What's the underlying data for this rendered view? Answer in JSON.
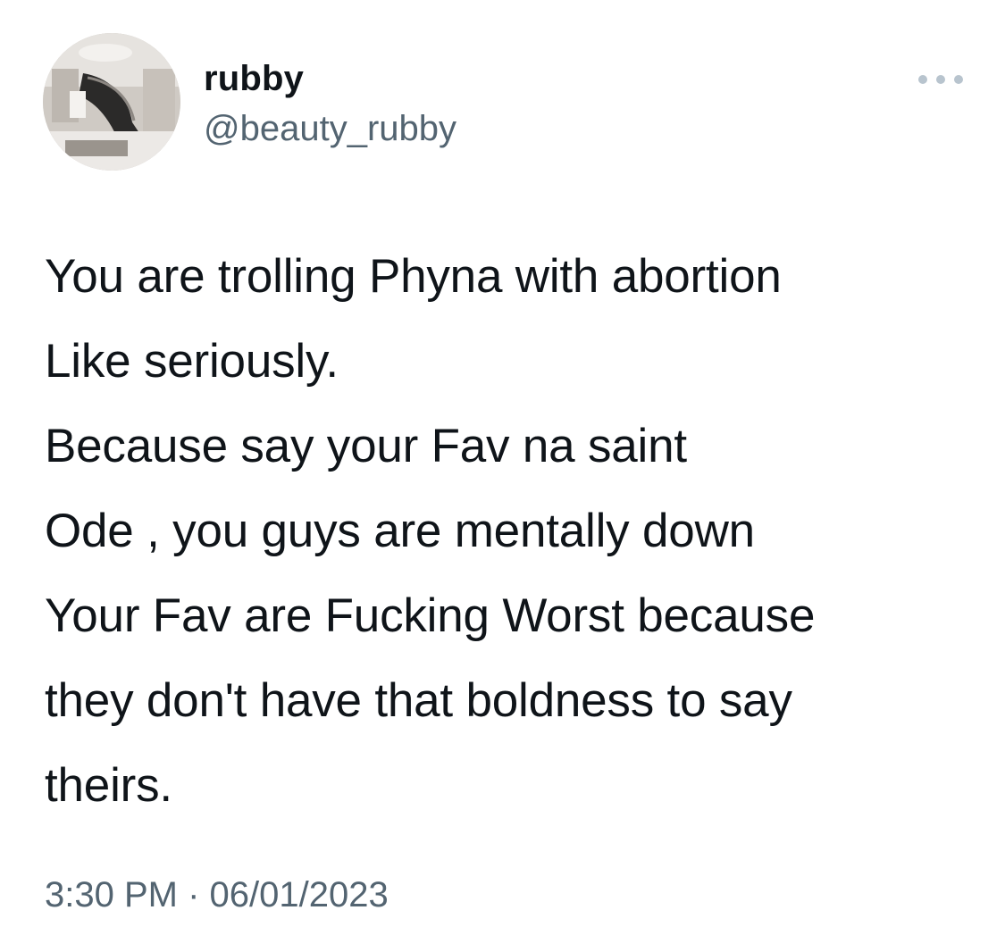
{
  "author": {
    "display_name": "rubby",
    "handle": "@beauty_rubby",
    "avatar_icon": "avatar-photo-staircase-interior"
  },
  "menu": {
    "icon": "more-options-icon"
  },
  "tweet": {
    "lines": [
      "You are trolling Phyna with abortion",
      "Like seriously.",
      "Because say your Fav na saint",
      "Ode , you guys are mentally down",
      "Your Fav are Fucking Worst because",
      "they don't have that boldness to say",
      "theirs."
    ]
  },
  "meta": {
    "timestamp": "3:30 PM · 06/01/2023"
  },
  "colors": {
    "primary_text": "#0f1419",
    "secondary_text": "#536471",
    "dots": "#b8c4ce",
    "background": "#ffffff"
  }
}
